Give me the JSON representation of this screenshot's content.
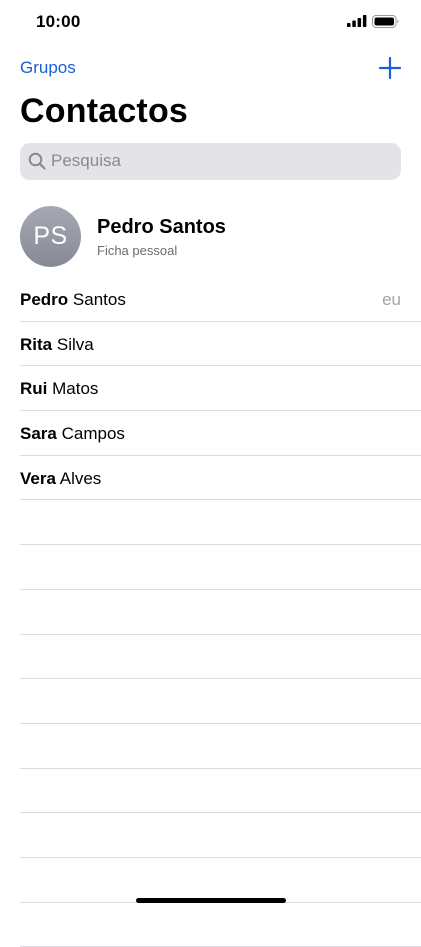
{
  "status_bar": {
    "time": "10:00"
  },
  "nav": {
    "groups_label": "Grupos",
    "add_icon": "plus-icon"
  },
  "title": "Contactos",
  "search": {
    "placeholder": "Pesquisa",
    "icon": "search-icon"
  },
  "my_card": {
    "initials": "PS",
    "name": "Pedro Santos",
    "subtitle": "Ficha pessoal"
  },
  "contacts": [
    {
      "first": "Pedro",
      "last": "Santos",
      "tag": "eu"
    },
    {
      "first": "Rita",
      "last": "Silva"
    },
    {
      "first": "Rui",
      "last": "Matos"
    },
    {
      "first": "Sara",
      "last": "Campos"
    },
    {
      "first": "Vera",
      "last": "Alves"
    }
  ],
  "colors": {
    "accent": "#1a5fd6",
    "search_bg": "#e3e3e8",
    "separator": "#dcdce0",
    "secondary_text": "#6d6d72"
  }
}
